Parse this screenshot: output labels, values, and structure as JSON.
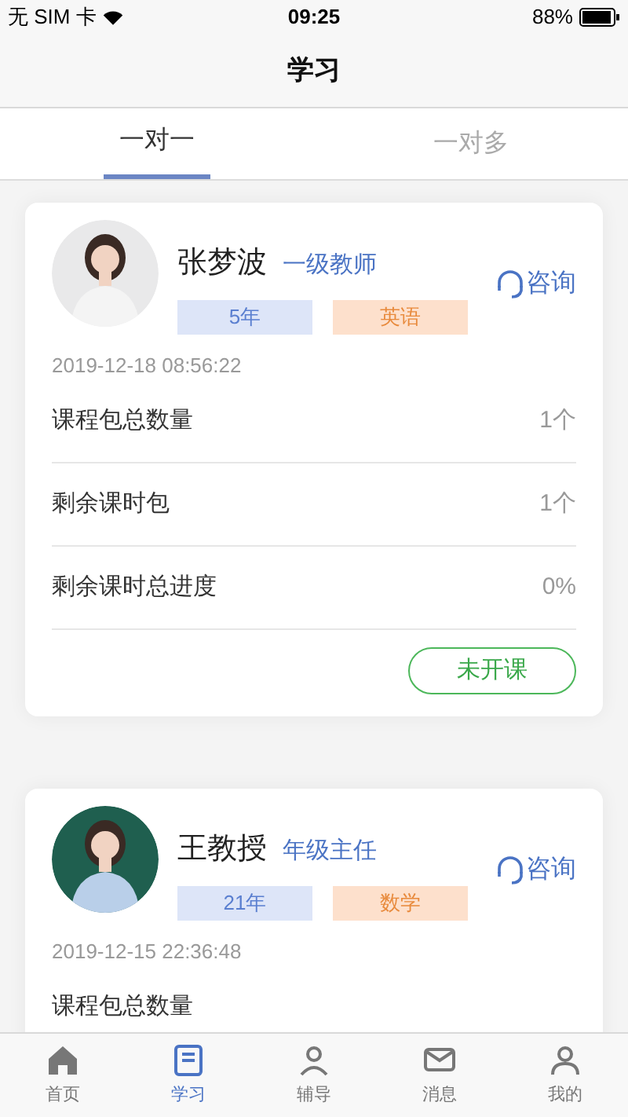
{
  "status_bar": {
    "carrier": "无 SIM 卡",
    "time": "09:25",
    "battery": "88%"
  },
  "nav_bar": {
    "title": "学习"
  },
  "tabs": [
    {
      "label": "一对一",
      "selected": true
    },
    {
      "label": "一对多",
      "selected": false
    }
  ],
  "cards": [
    {
      "name": "张梦波",
      "title": "一级教师",
      "years": "5年",
      "subject": "英语",
      "consult": "咨询",
      "time": "2019-12-18 08:56:22",
      "rows": [
        {
          "label": "课程包总数量",
          "value": "1个"
        },
        {
          "label": "剩余课时包",
          "value": "1个"
        },
        {
          "label": "剩余课时总进度",
          "value": "0%"
        }
      ],
      "status": "未开课"
    },
    {
      "name": "王教授",
      "title": "年级主任",
      "years": "21年",
      "subject": "数学",
      "consult": "咨询",
      "time": "2019-12-15 22:36:48",
      "rows": [
        {
          "label": "课程包总数量"
        }
      ]
    }
  ],
  "tab_bar": [
    {
      "label": "首页",
      "selected": false
    },
    {
      "label": "学习",
      "selected": true
    },
    {
      "label": "辅导",
      "selected": false
    },
    {
      "label": "消息",
      "selected": false
    },
    {
      "label": "我的",
      "selected": false
    }
  ]
}
